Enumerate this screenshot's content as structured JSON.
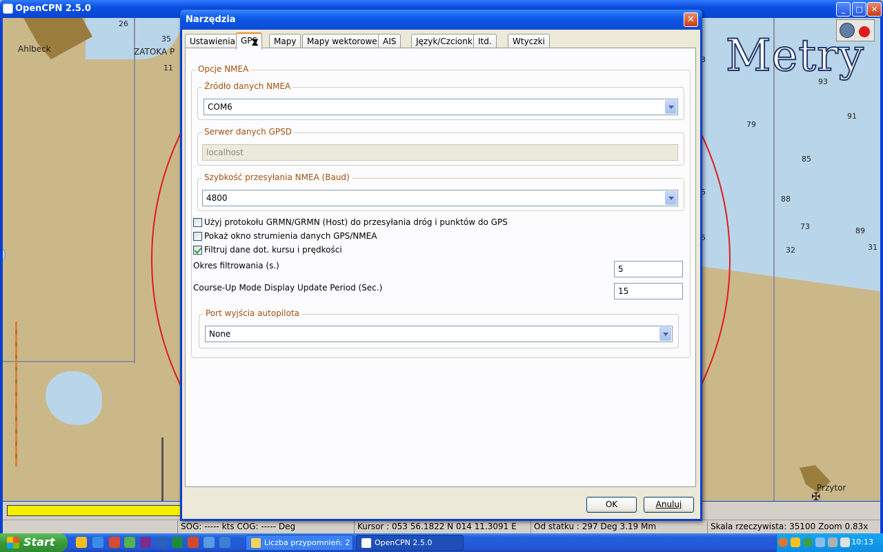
{
  "main_window": {
    "title": "OpenCPN 2.5.0"
  },
  "chart": {
    "place_labels": [
      "Ahlbeck",
      "ZATOKA P",
      "Przytor"
    ],
    "overlay_text": "Metry",
    "soundings": [
      "26",
      "35",
      "11",
      "79",
      "93",
      "91",
      "85",
      "88",
      "73",
      "89",
      "32",
      "31",
      "5",
      "5",
      "3"
    ]
  },
  "status_bar": {
    "sog_cog": "SOG: ----- kts  COG: ----- Deg",
    "cursor": "Kursor :  053 56.1822 N 014 11.3091 E",
    "from_ship": "Od statku :  297 Deg      3.19 Mm",
    "scale": "Skala rzeczywista:    35100  Zoom 0.83x"
  },
  "dialog": {
    "title": "Narzędzia",
    "close_symbol": "✕",
    "tabs": [
      {
        "label": "Ustawienia"
      },
      {
        "label": "GPS"
      },
      {
        "label": "Mapy"
      },
      {
        "label": "Mapy wektorowe"
      },
      {
        "label": "AIS"
      },
      {
        "label": "Język/Czcionki"
      },
      {
        "label": "Itd."
      },
      {
        "label": "Wtyczki"
      }
    ],
    "active_tab": "GPS",
    "nmea_group_label": "Opcje NMEA",
    "nmea_source": {
      "label": "Źródło danych NMEA",
      "value": "COM6"
    },
    "gpsd_server": {
      "label": "Serwer danych GPSD",
      "value": "localhost"
    },
    "baud_rate": {
      "label": "Szybkość przesyłania NMEA (Baud)",
      "value": "4800"
    },
    "checkboxes": [
      {
        "label": "Użyj protokołu GRMN/GRMN (Host) do przesyłania dróg i punktów do GPS",
        "checked": false
      },
      {
        "label": "Pokaż okno strumienia danych GPS/NMEA",
        "checked": false
      },
      {
        "label": "Filtruj dane dot. kursu i prędkości",
        "checked": true
      }
    ],
    "filter_period": {
      "label": "Okres filtrowania (s.)",
      "value": "5"
    },
    "course_up_period": {
      "label": "Course-Up Mode Display Update Period (Sec.)",
      "value": "15"
    },
    "autopilot": {
      "label": "Port wyjścia autopilota",
      "value": "None"
    },
    "ok_label": "OK",
    "cancel_label": "Anuluj"
  },
  "taskbar": {
    "start_label": "Start",
    "tasks": [
      {
        "label": "Liczba przypomnień: 2"
      },
      {
        "label": "OpenCPN 2.5.0"
      }
    ],
    "clock": "10:13"
  },
  "colors": {
    "accent_tab": "#e68b2c",
    "group_label": "#a24f0f",
    "progress": "#f4ef00",
    "ring": "#e01a1a"
  }
}
